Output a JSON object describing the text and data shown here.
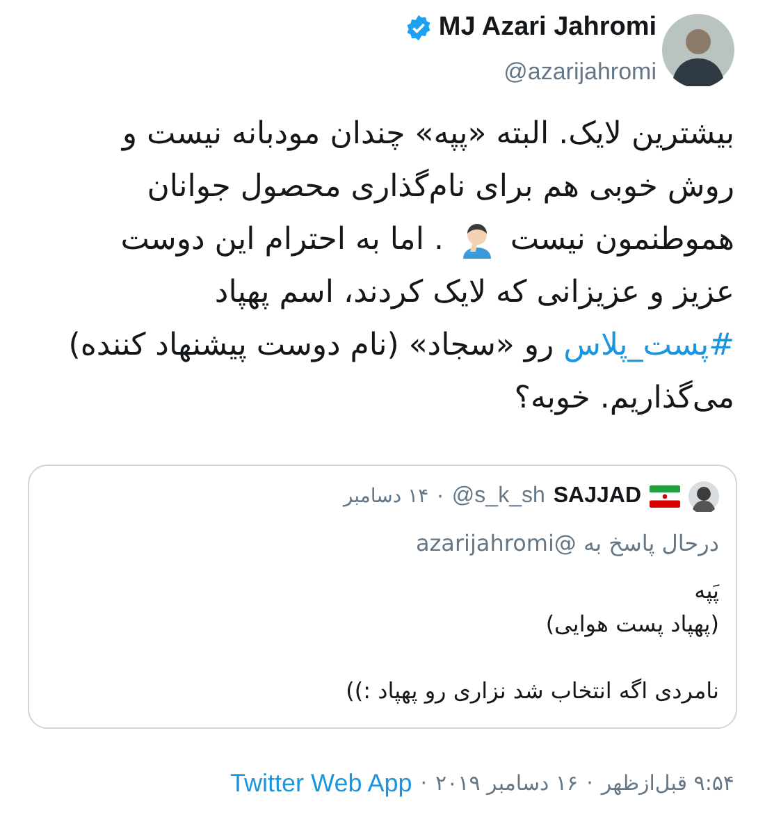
{
  "author": {
    "name": "MJ Azari Jahromi",
    "verified": true,
    "handle": "@azarijahromi"
  },
  "body": [
    {
      "kind": "text",
      "text": "بیشترین لایک. البته «پپه» چندان مودبانه نیست و روش خوبی هم برای نام‌گذاری محصول جوانان هموطنمون نیست "
    },
    {
      "kind": "emoji"
    },
    {
      "kind": "text",
      "text": " . اما به احترام این دوست عزیز و عزیزانی که لایک کردند، اسم پهپاد "
    },
    {
      "kind": "hashtag",
      "text": "#پست_پلاس"
    },
    {
      "kind": "text",
      "text": " رو «سجاد» (نام دوست پیشنهاد کننده) می‌گذاریم. خوبه؟"
    }
  ],
  "quoted": {
    "name": "SAJJAD",
    "handle": "@s_k_sh",
    "separator": "·",
    "date": "۱۴ دسامبر",
    "reply_to": "درحال پاسخ به @azarijahromi",
    "paragraphs": [
      [
        "پَپه",
        "(پهپاد پست هوایی)"
      ],
      [
        "نامردی اگه انتخاب شد نزاری رو پهپاد :))"
      ]
    ]
  },
  "footer": {
    "time": "۹:۵۴ قبل‌ازظهر",
    "separator_1": "·",
    "date": "۱۶ دسامبر ۲۰۱۹",
    "separator_2": "·",
    "source": "Twitter Web App"
  }
}
